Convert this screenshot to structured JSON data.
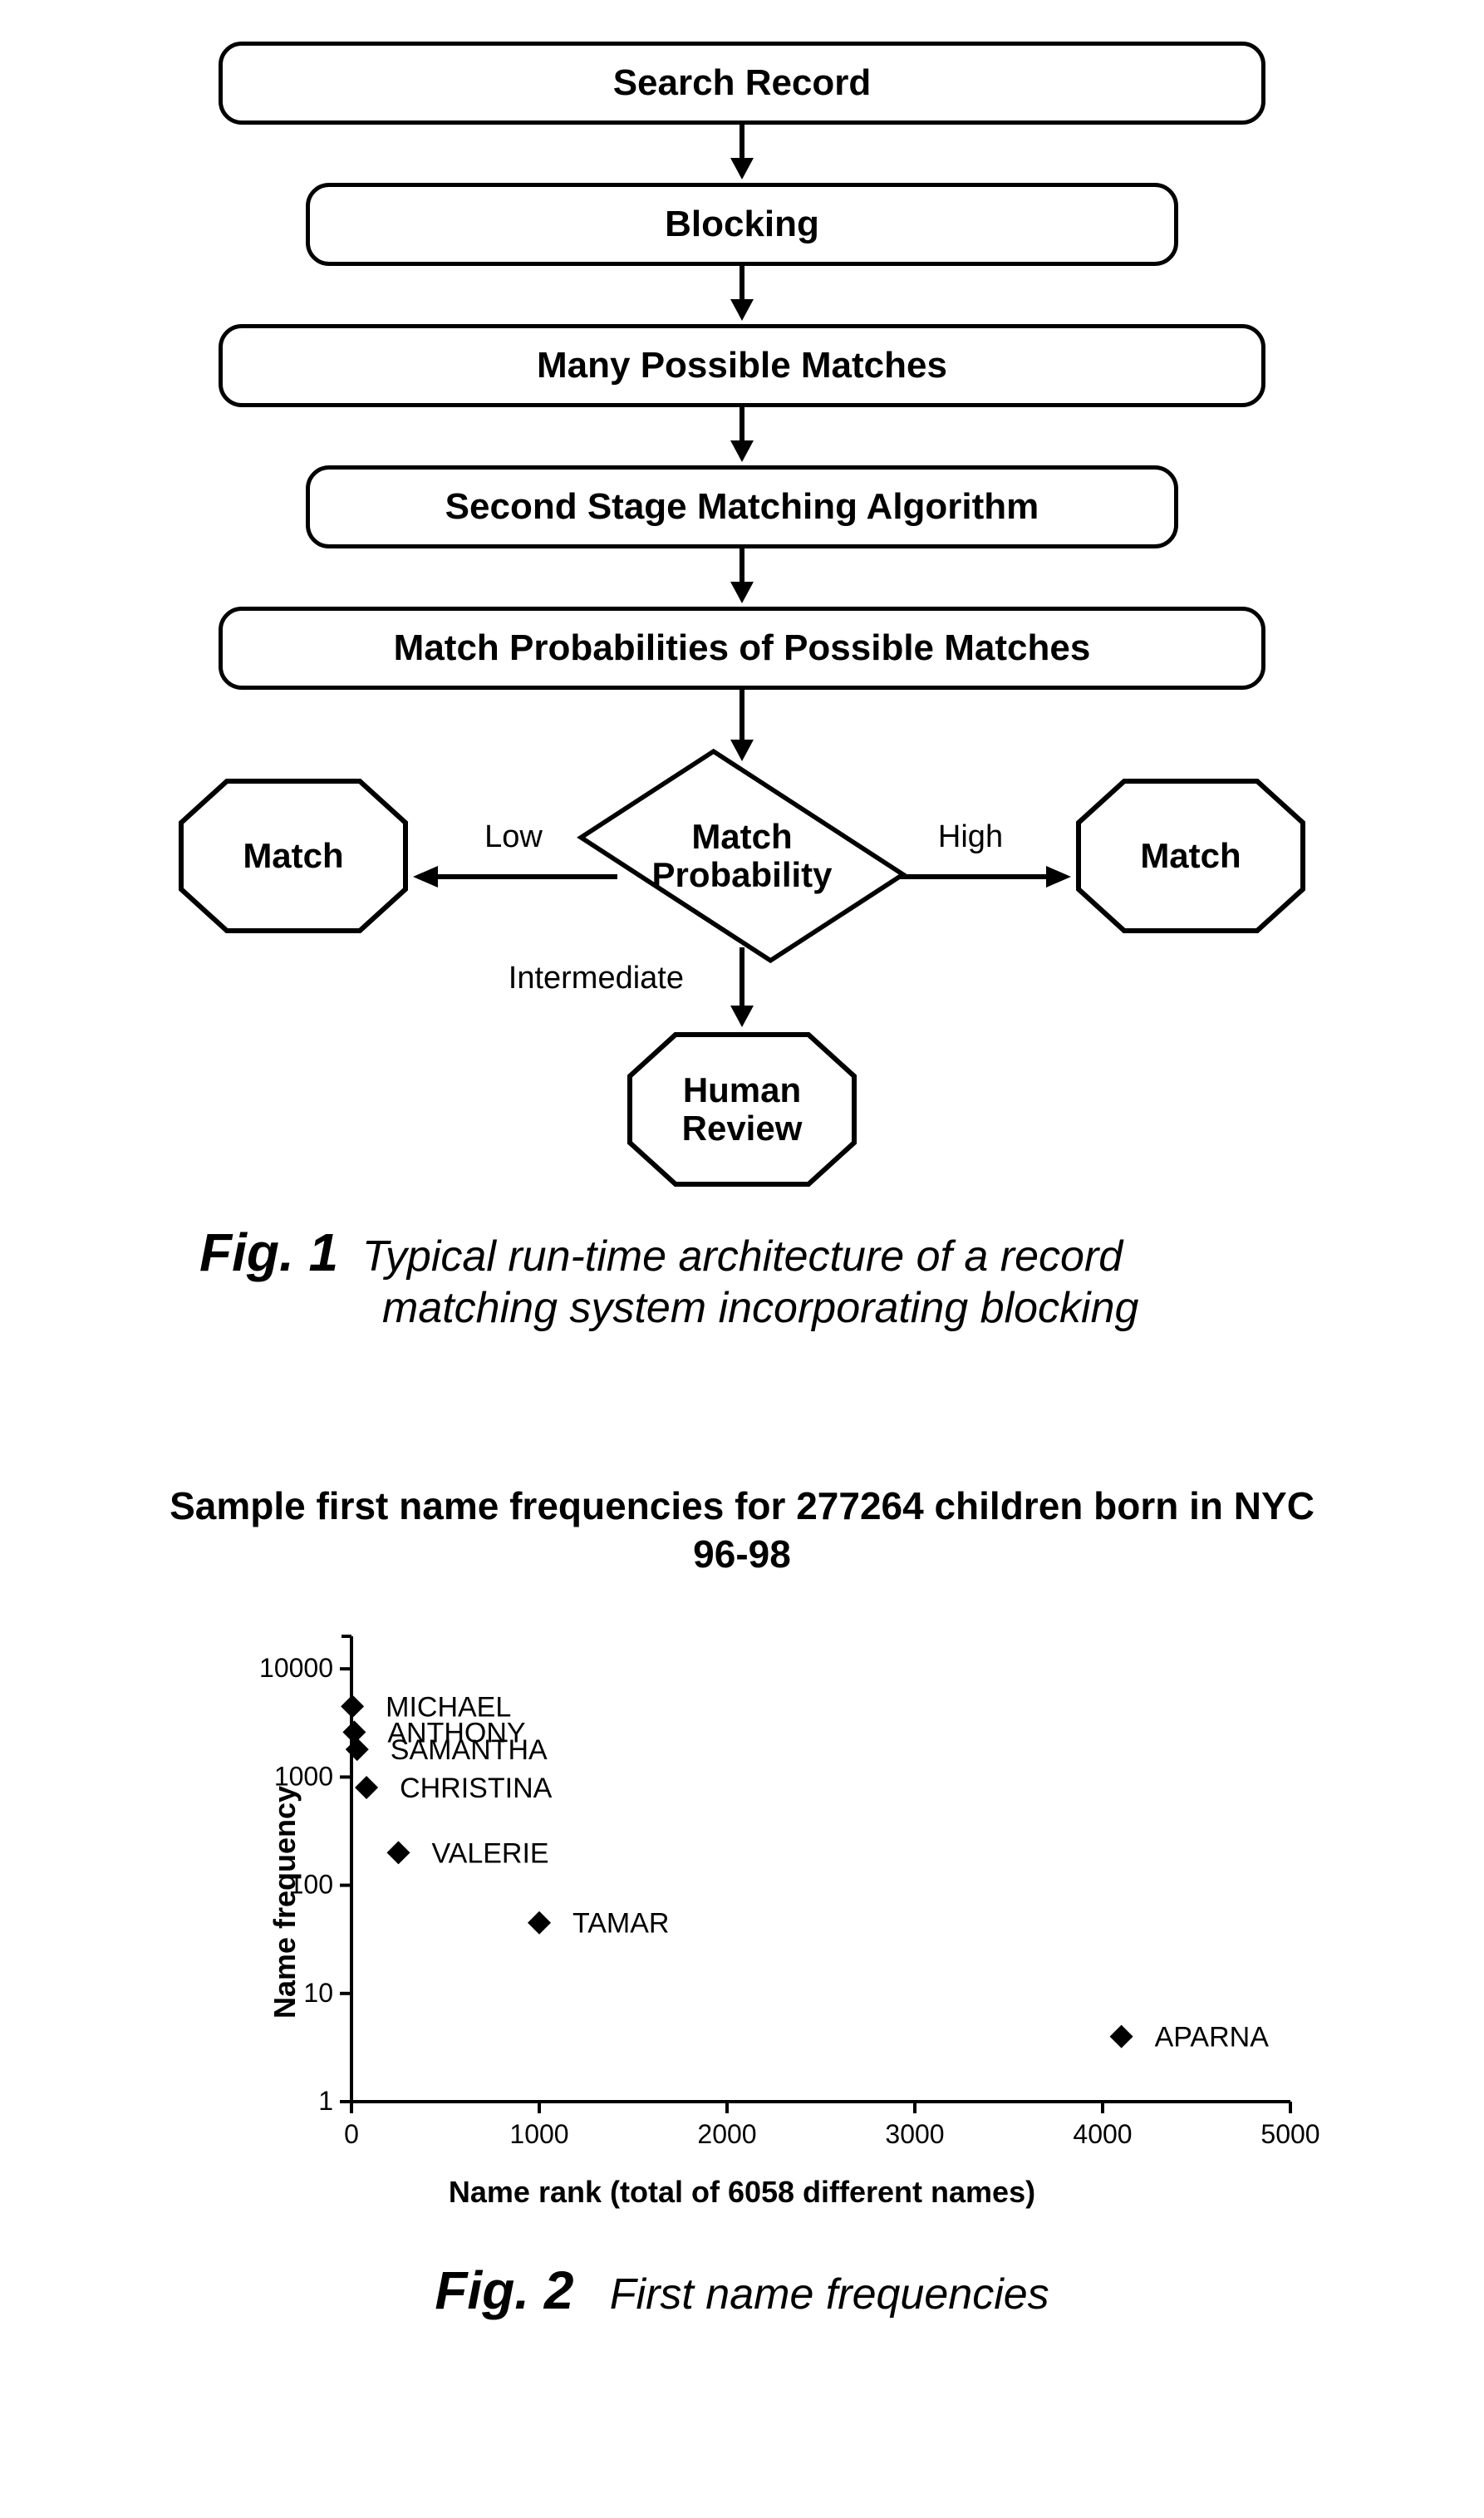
{
  "flow": {
    "b1": "Search Record",
    "b2": "Blocking",
    "b3": "Many Possible Matches",
    "b4": "Second Stage Matching Algorithm",
    "b5": "Match Probabilities of Possible Matches",
    "decision_l1": "Match",
    "decision_l2": "Probability",
    "edge_low": "Low",
    "edge_high": "High",
    "edge_mid": "Intermediate",
    "term_left": "Match",
    "term_right": "Match",
    "term_bottom_l1": "Human",
    "term_bottom_l2": "Review"
  },
  "fig1": {
    "num": "Fig. 1",
    "text_l1": "Typical run-time architecture of a record",
    "text_l2": "matching system incorporating blocking"
  },
  "chart_data": {
    "type": "scatter",
    "title": "Sample first name frequencies for 277264 children born in NYC 96-98",
    "xlabel": "Name rank (total of 6058 different names)",
    "ylabel": "Name frequency",
    "xlim": [
      0,
      5000
    ],
    "ylim_log": [
      1,
      20000
    ],
    "x_ticks": [
      0,
      1000,
      2000,
      3000,
      4000,
      5000
    ],
    "y_ticks": [
      1,
      10,
      100,
      1000,
      10000
    ],
    "points": [
      {
        "label": "MICHAEL",
        "x": 5,
        "y": 4500
      },
      {
        "label": "ANTHONY",
        "x": 15,
        "y": 2600
      },
      {
        "label": "SAMANTHA",
        "x": 30,
        "y": 1800
      },
      {
        "label": "CHRISTINA",
        "x": 80,
        "y": 800
      },
      {
        "label": "VALERIE",
        "x": 250,
        "y": 200
      },
      {
        "label": "TAMAR",
        "x": 1000,
        "y": 45
      },
      {
        "label": "APARNA",
        "x": 4100,
        "y": 4
      }
    ]
  },
  "fig2": {
    "num": "Fig. 2",
    "text": "First name frequencies"
  }
}
